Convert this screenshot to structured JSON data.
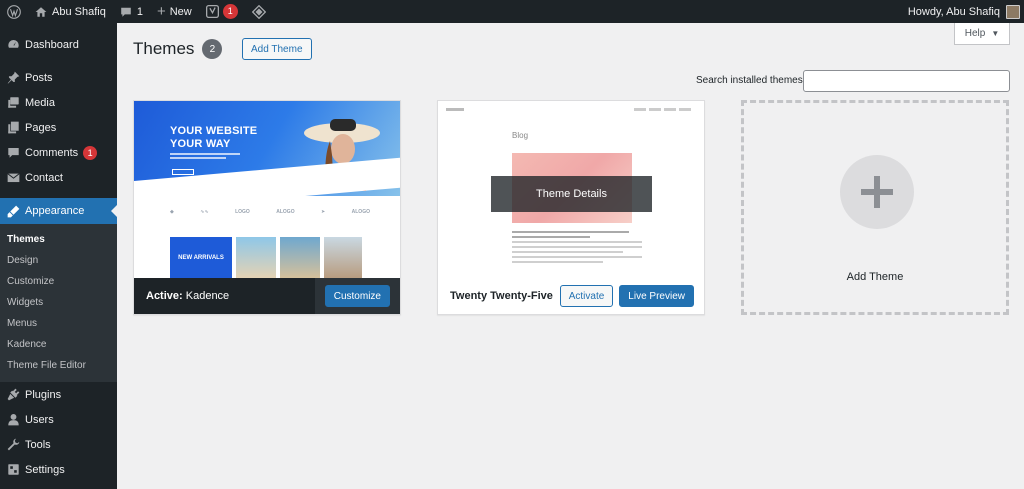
{
  "adminbar": {
    "comments_count": "1",
    "new_label": "New",
    "site_name": "Abu Shafiq",
    "yoast_count": "1",
    "howdy": "Howdy, Abu Shafiq"
  },
  "sidebar": {
    "items_top": [
      {
        "label": "Dashboard",
        "icon": "dashboard-icon"
      }
    ],
    "items_content": [
      {
        "label": "Posts",
        "icon": "pin-icon"
      },
      {
        "label": "Media",
        "icon": "media-icon"
      },
      {
        "label": "Pages",
        "icon": "pages-icon"
      },
      {
        "label": "Comments",
        "icon": "comment-icon",
        "count": "1"
      },
      {
        "label": "Contact",
        "icon": "envelope-icon"
      }
    ],
    "appearance": {
      "label": "Appearance",
      "icon": "brush-icon"
    },
    "submenu": [
      {
        "label": "Themes",
        "active": true
      },
      {
        "label": "Design"
      },
      {
        "label": "Customize"
      },
      {
        "label": "Widgets"
      },
      {
        "label": "Menus"
      },
      {
        "label": "Kadence"
      },
      {
        "label": "Theme File Editor"
      }
    ],
    "items_bottom": [
      {
        "label": "Plugins",
        "icon": "plug-icon"
      },
      {
        "label": "Users",
        "icon": "user-icon"
      },
      {
        "label": "Tools",
        "icon": "wrench-icon"
      },
      {
        "label": "Settings",
        "icon": "settings-icon"
      }
    ]
  },
  "content": {
    "help_label": "Help",
    "page_title": "Themes",
    "theme_count": "2",
    "add_theme_button": "Add Theme",
    "search_label": "Search installed themes",
    "themes": [
      {
        "active_prefix": "Active:",
        "name": "Kadence",
        "action": "Customize",
        "preview": {
          "headline_1": "YOUR WEBSITE",
          "headline_2": "YOUR WAY",
          "logos": [
            "LOGO",
            "ALOGO",
            "Logo",
            "ALOGO"
          ],
          "tile_text": "NEW ARRIVALS"
        }
      },
      {
        "name": "Twenty Twenty-Five",
        "activate": "Activate",
        "live_preview": "Live Preview",
        "overlay": "Theme Details",
        "preview": {
          "blog_label": "Blog"
        }
      }
    ],
    "add_theme_card": "Add Theme"
  }
}
